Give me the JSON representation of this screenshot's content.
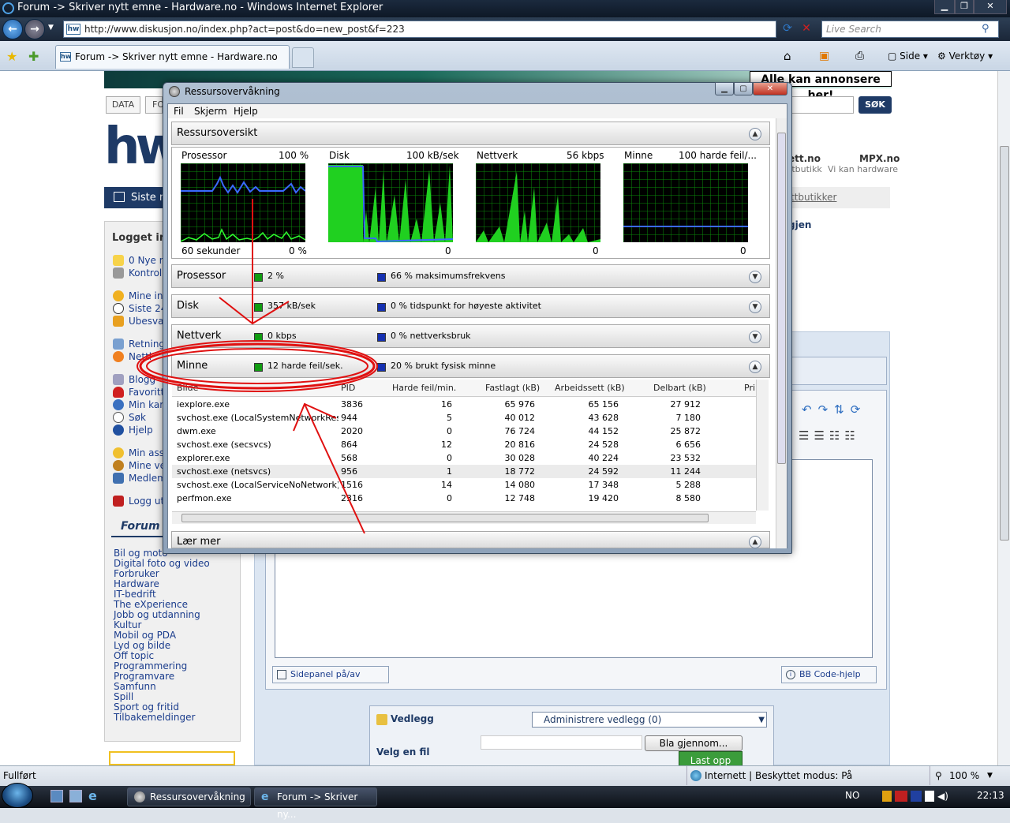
{
  "ie": {
    "title": "Forum -> Skriver nytt emne - Hardware.no - Windows Internet Explorer",
    "url": "http://www.diskusjon.no/index.php?act=post&do=new_post&f=223",
    "search_placeholder": "Live Search",
    "tab_label": "Forum -> Skriver nytt emne - Hardware.no",
    "toolbar": {
      "page": "Side",
      "tools": "Verktøy"
    },
    "status_left": "Fullført",
    "status_zone": "Internett | Beskyttet modus: På",
    "zoom": "100 %"
  },
  "site": {
    "ad_text": "Alle kan annonsere her!",
    "data_tab": "DATA",
    "data_tab_partial": "FO",
    "search_button": "SØK",
    "siste_btn": "Siste n",
    "right_brand1": "ett.no",
    "right_brand1_sub": "ttbutikk",
    "right_brand2": "MPX.no",
    "right_brand2_sub": "Vi kan hardware",
    "right_tab": "ttbutikker",
    "right_link": "gjen",
    "sidebar_title": "Logget in",
    "sidebar_links": [
      "0 Nye m",
      "Kontroll",
      "Mine inr",
      "Siste 24",
      "Ubesva",
      "Retning",
      "Nettl",
      "Blogg",
      "Favoritt",
      "Min kar",
      "Søk",
      "Hjelp",
      "Min ass",
      "Mine ve",
      "Medlem",
      "Logg ut"
    ],
    "forum_title": "Forum",
    "forums": [
      "Bil og moto",
      "Digital foto og video",
      "Forbruker",
      "Hardware",
      "IT-bedrift",
      "The eXperience",
      "Jobb og utdanning",
      "Kultur",
      "Mobil og PDA",
      "Lyd og bilde",
      "Off topic",
      "Programmering",
      "Programvare",
      "Samfunn",
      "Spill",
      "Sport og fritid",
      "Tilbakemeldinger"
    ],
    "sidepanel_btn": "Sidepanel på/av",
    "bbcode_btn": "BB Code-hjelp",
    "attach_title": "Vedlegg",
    "attach_select": "Administrere vedlegg (0)",
    "choose_file": "Velg en fil",
    "browse_btn": "Bla gjennom...",
    "upload_btn": "Last opp"
  },
  "resmon": {
    "title": "Ressursovervåkning",
    "menu": [
      "Fil",
      "Skjerm",
      "Hjelp"
    ],
    "overview_title": "Ressursoversikt",
    "charts": [
      {
        "name": "Prosessor",
        "max": "100 %",
        "bottom_left": "60 sekunder",
        "bottom_right": "0 %"
      },
      {
        "name": "Disk",
        "max": "100 kB/sek",
        "bottom_left": "",
        "bottom_right": "0"
      },
      {
        "name": "Nettverk",
        "max": "56 kbps",
        "bottom_left": "",
        "bottom_right": "0"
      },
      {
        "name": "Minne",
        "max": "100 harde feil/...",
        "bottom_left": "",
        "bottom_right": "0"
      }
    ],
    "sections": [
      {
        "name": "Prosessor",
        "green": "2 %",
        "blue": "66 % maksimumsfrekvens"
      },
      {
        "name": "Disk",
        "green": "357 kB/sek",
        "blue": "0 % tidspunkt for høyeste aktivitet"
      },
      {
        "name": "Nettverk",
        "green": "0 kbps",
        "blue": "0 % nettverksbruk"
      },
      {
        "name": "Minne",
        "green": "12 harde feil/sek.",
        "blue": "20 % brukt fysisk minne"
      }
    ],
    "columns": [
      "Bilde",
      "PID",
      "Harde feil/min.",
      "Fastlagt (kB)",
      "Arbeidssett (kB)",
      "Delbart (kB)",
      "Pri"
    ],
    "rows": [
      [
        "iexplore.exe",
        "3836",
        "16",
        "65 976",
        "65 156",
        "27 912"
      ],
      [
        "svchost.exe (LocalSystemNetworkRest...",
        "944",
        "5",
        "40 012",
        "43 628",
        "7 180"
      ],
      [
        "dwm.exe",
        "2020",
        "0",
        "76 724",
        "44 152",
        "25 872"
      ],
      [
        "svchost.exe (secsvcs)",
        "864",
        "12",
        "20 816",
        "24 528",
        "6 656"
      ],
      [
        "explorer.exe",
        "568",
        "0",
        "30 028",
        "40 224",
        "23 532"
      ],
      [
        "svchost.exe (netsvcs)",
        "956",
        "1",
        "18 772",
        "24 592",
        "11 244"
      ],
      [
        "svchost.exe (LocalServiceNoNetwork)",
        "1516",
        "14",
        "14 080",
        "17 348",
        "5 288"
      ],
      [
        "perfmon.exe",
        "2316",
        "0",
        "12 748",
        "19 420",
        "8 580"
      ]
    ],
    "learn_more": "Lær mer"
  },
  "taskbar": {
    "items": [
      "Ressursovervåkning",
      "Forum -> Skriver ny..."
    ],
    "lang": "NO",
    "time": "22:13"
  },
  "colors": {
    "accent_green": "#119c11",
    "accent_blue": "#1530b0",
    "annotation_red": "#e01010"
  }
}
